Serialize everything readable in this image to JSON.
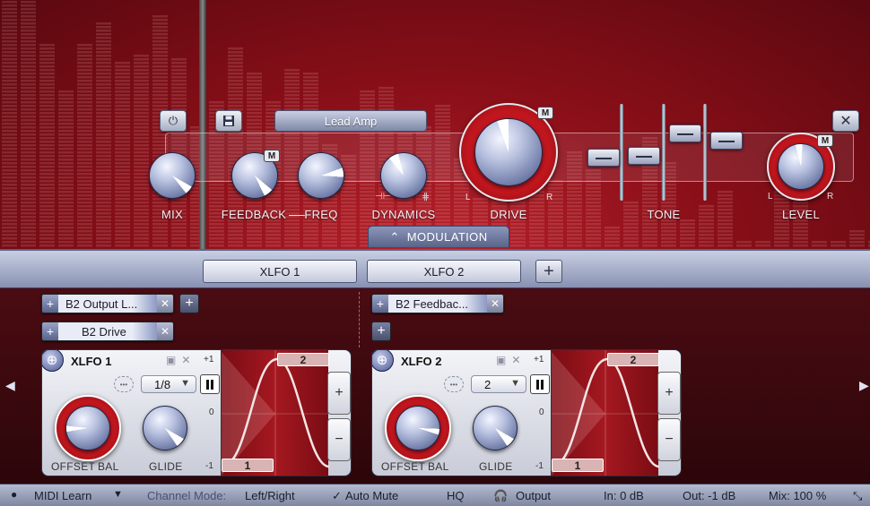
{
  "effect": {
    "preset_name": "Lead Amp",
    "knobs": {
      "mix": "MIX",
      "feedback": "FEEDBACK",
      "freq": "FREQ",
      "dynamics": "DYNAMICS",
      "drive": "DRIVE",
      "tone": "TONE",
      "level": "LEVEL"
    },
    "modulation_badge": "M",
    "left_label": "L",
    "right_label": "R"
  },
  "modulation_tab": {
    "label": "MODULATION"
  },
  "lfo_tabs": [
    {
      "label": "XLFO 1"
    },
    {
      "label": "XLFO 2"
    }
  ],
  "lfo1": {
    "targets": [
      {
        "name": "B2 Output L..."
      },
      {
        "name": "B2 Drive"
      }
    ],
    "title": "XLFO 1",
    "rate": "1/8",
    "offset_label": "OFFSET",
    "bal_label": "BAL",
    "glide_label": "GLIDE",
    "scale_top": "+1",
    "scale_mid": "0",
    "scale_bottom": "-1",
    "step_top": "2",
    "step_bottom": "1"
  },
  "lfo2": {
    "targets": [
      {
        "name": "B2 Feedbac..."
      }
    ],
    "title": "XLFO 2",
    "rate": "2",
    "offset_label": "OFFSET",
    "bal_label": "BAL",
    "glide_label": "GLIDE",
    "scale_top": "+1",
    "scale_mid": "0",
    "scale_bottom": "-1",
    "step_top": "2",
    "step_bottom": "1"
  },
  "status": {
    "midi_learn": "MIDI Learn",
    "channel_mode_label": "Channel Mode:",
    "channel_mode_value": "Left/Right",
    "auto_mute": "Auto Mute",
    "hq": "HQ",
    "output": "Output",
    "in": "In: 0 dB",
    "out": "Out: -1 dB",
    "mix": "Mix: 100 %"
  },
  "colors": {
    "accent_red": "#b8202a",
    "panel_blue": "#8891b2"
  }
}
